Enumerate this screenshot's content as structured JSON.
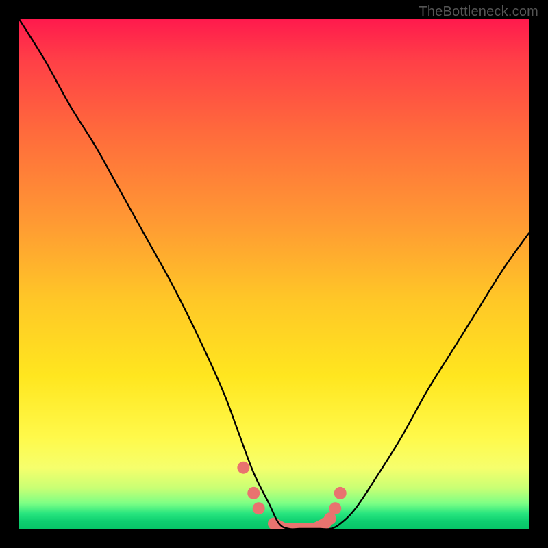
{
  "watermark": "TheBottleneck.com",
  "chart_data": {
    "type": "line",
    "title": "",
    "xlabel": "",
    "ylabel": "",
    "xlim": [
      0,
      100
    ],
    "ylim": [
      0,
      100
    ],
    "series": [
      {
        "name": "bottleneck-curve",
        "x": [
          0,
          5,
          10,
          15,
          20,
          25,
          30,
          35,
          40,
          43,
          46,
          49,
          51,
          53,
          55,
          57,
          59,
          61,
          63,
          66,
          70,
          75,
          80,
          85,
          90,
          95,
          100
        ],
        "values": [
          100,
          92,
          83,
          75,
          66,
          57,
          48,
          38,
          27,
          19,
          11,
          5,
          1,
          0,
          0,
          0,
          0,
          0,
          1,
          4,
          10,
          18,
          27,
          35,
          43,
          51,
          58
        ]
      }
    ],
    "markers": {
      "name": "highlight-dots",
      "x": [
        44,
        46,
        47,
        50,
        52,
        55,
        58,
        60,
        61,
        62,
        63
      ],
      "values": [
        12,
        7,
        4,
        1,
        0,
        0,
        0,
        1,
        2,
        4,
        7
      ],
      "color": "#e9736f",
      "radius_px": 9
    },
    "gradient_stops": [
      {
        "pos": 0.0,
        "color": "#ff1a4d"
      },
      {
        "pos": 0.4,
        "color": "#ff9a33"
      },
      {
        "pos": 0.7,
        "color": "#ffe61f"
      },
      {
        "pos": 0.92,
        "color": "#c9ff74"
      },
      {
        "pos": 1.0,
        "color": "#07c668"
      }
    ]
  }
}
